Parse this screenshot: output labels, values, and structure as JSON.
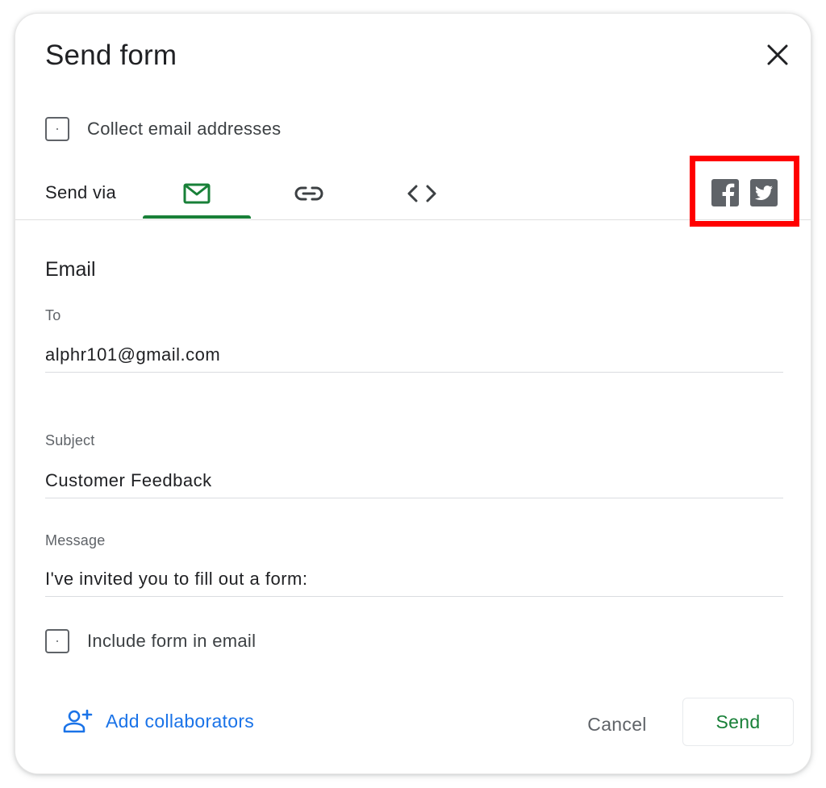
{
  "dialog": {
    "title": "Send form",
    "close_icon": "close-icon"
  },
  "collect_email": {
    "label": "Collect email addresses",
    "checked": false
  },
  "send_via": {
    "label": "Send via",
    "tabs": [
      {
        "icon": "email-icon",
        "selected": true
      },
      {
        "icon": "link-icon",
        "selected": false
      },
      {
        "icon": "embed-code-icon",
        "selected": false
      }
    ],
    "social": [
      {
        "icon": "facebook-icon"
      },
      {
        "icon": "twitter-icon"
      }
    ]
  },
  "email": {
    "heading": "Email",
    "to_label": "To",
    "to_value": "alphr101@gmail.com",
    "subject_label": "Subject",
    "subject_value": "Customer Feedback",
    "message_label": "Message",
    "message_value": "I've invited you to fill out a form:",
    "include_form_label": "Include form in email",
    "include_form_checked": false
  },
  "footer": {
    "add_collaborators": "Add collaborators",
    "cancel": "Cancel",
    "send": "Send"
  },
  "colors": {
    "accent_green": "#188038",
    "link_blue": "#1a73e8",
    "highlight_red": "#ff0000",
    "social_grey": "#5f6368"
  }
}
